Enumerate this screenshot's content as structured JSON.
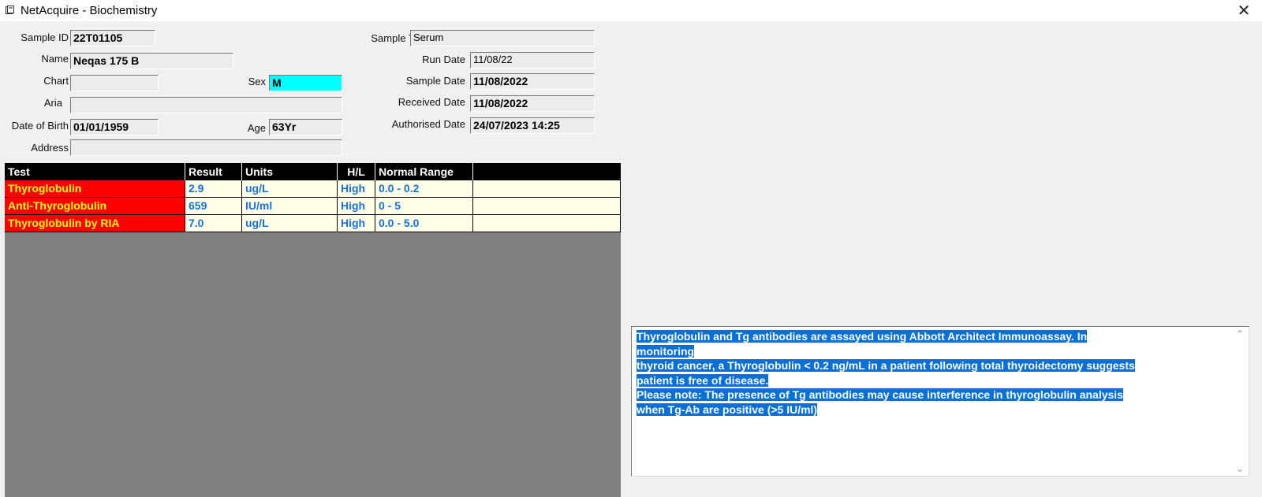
{
  "window": {
    "title": "NetAcquire - Biochemistry",
    "close_glyph": "✕"
  },
  "demographics": {
    "sample_id_label": "Sample ID",
    "sample_id": "22T01105",
    "name_label": "Name",
    "name": "Neqas 175 B",
    "chart_label": "Chart",
    "chart": "",
    "sex_label": "Sex",
    "sex": "M",
    "aria_label": "Aria",
    "aria": "",
    "dob_label": "Date of Birth",
    "dob": "01/01/1959",
    "age_label": "Age",
    "age": "63Yr",
    "address_label": "Address",
    "address": "",
    "sample_type_label": "Sample Type",
    "sample_type": "Serum",
    "run_date_label": "Run Date",
    "run_date": "11/08/22",
    "sample_date_label": "Sample Date",
    "sample_date": "11/08/2022",
    "received_date_label": "Received Date",
    "received_date": "11/08/2022",
    "authorised_date_label": "Authorised Date",
    "authorised_date": "24/07/2023 14:25"
  },
  "results": {
    "headers": [
      "Test",
      "Result",
      "Units",
      "H/L",
      "Normal Range",
      ""
    ],
    "rows": [
      {
        "test": "Thyroglobulin",
        "result": "2.9",
        "units": "ug/L",
        "hl": "High",
        "range": "0.0 - 0.2"
      },
      {
        "test": "Anti-Thyroglobulin",
        "result": "659",
        "units": "IU/ml",
        "hl": "High",
        "range": "0 - 5"
      },
      {
        "test": "Thyroglobulin by RIA",
        "result": "7.0",
        "units": "ug/L",
        "hl": "High",
        "range": "0.0 - 5.0"
      }
    ]
  },
  "comment": {
    "lines": [
      "Thyroglobulin and Tg antibodies are assayed using Abbott Architect Immunoassay. In ",
      "monitoring",
      "thyroid cancer, a Thyroglobulin < 0.2 ng/mL in a patient following total thyroidectomy suggests",
      "patient is free of disease. ",
      "Please note: The presence of Tg antibodies may cause interference in thyroglobulin analysis",
      "when Tg-Ab are positive (>5 IU/ml)"
    ]
  },
  "colors": {
    "test_cell_bg": "#ff0000",
    "test_cell_text": "#ffff00",
    "value_text": "#1a6fd8",
    "row_bg": "#ffffe8",
    "sex_field_bg": "#00ffff",
    "selection": "#0a6fd6",
    "grid_empty": "#808080"
  },
  "icons": {
    "app": "app-icon",
    "close": "close-icon",
    "scroll_up": "chevron-up-icon",
    "scroll_down": "chevron-down-icon"
  }
}
